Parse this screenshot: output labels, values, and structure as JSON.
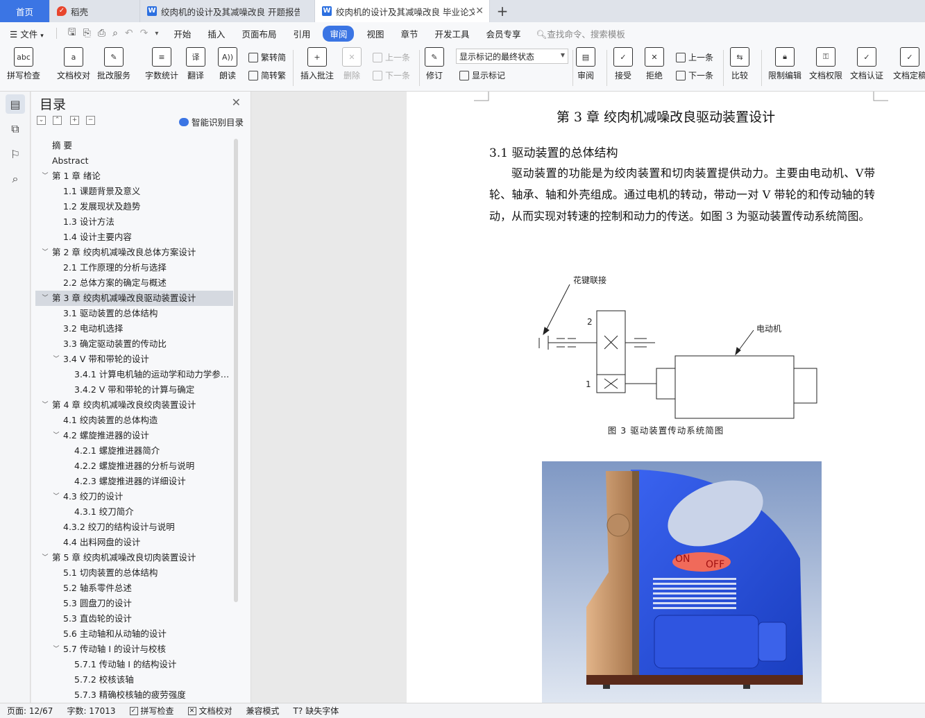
{
  "tabs": [
    {
      "label": "首页",
      "icon": "none"
    },
    {
      "label": "稻壳",
      "icon": "docer-icon"
    },
    {
      "label": "绞肉机的设计及其减噪改良 开题报告",
      "icon": "word-doc-icon"
    },
    {
      "label": "绞肉机的设计及其减噪改良 毕业论文",
      "icon": "word-doc-icon"
    }
  ],
  "menu": {
    "file": "文件",
    "items": [
      "开始",
      "插入",
      "页面布局",
      "引用",
      "审阅",
      "视图",
      "章节",
      "开发工具",
      "会员专享"
    ],
    "active": "审阅",
    "search_placeholder": "查找命令、搜索模板"
  },
  "ribbon": {
    "spellcheck": "拼写检查",
    "spellcheck_glyph": "abc",
    "doccheck": "文档校对",
    "batchservice": "批改服务",
    "wordcount": "字数统计",
    "translate": "翻译",
    "readaloud": "朗读",
    "trad": "繁转简",
    "simp": "简转繁",
    "insert_comment": "插入批注",
    "delete": "删除",
    "prev": "上一条",
    "next": "下一条",
    "revise": "修订",
    "mark_state": "显示标记的最终状态",
    "show_marks": "显示标记",
    "review": "审阅",
    "accept": "接受",
    "reject": "拒绝",
    "prev2": "上一条",
    "next2": "下一条",
    "compare": "比较",
    "restrict": "限制编辑",
    "permission": "文档权限",
    "certify": "文档认证",
    "finalize": "文档定稿"
  },
  "toc": {
    "title": "目录",
    "smart": "智能识别目录",
    "items": [
      {
        "label": "摘    要",
        "level": 1,
        "chev": ""
      },
      {
        "label": "Abstract",
        "level": 1,
        "chev": ""
      },
      {
        "label": "第 1 章  绪论",
        "level": 1,
        "chev": "v"
      },
      {
        "label": "1.1 课题背景及意义",
        "level": 2,
        "chev": ""
      },
      {
        "label": "1.2 发展现状及趋势",
        "level": 2,
        "chev": ""
      },
      {
        "label": "1.3 设计方法",
        "level": 2,
        "chev": ""
      },
      {
        "label": "1.4 设计主要内容",
        "level": 2,
        "chev": ""
      },
      {
        "label": "第 2 章  绞肉机减噪改良总体方案设计",
        "level": 1,
        "chev": "v"
      },
      {
        "label": "2.1  工作原理的分析与选择",
        "level": 2,
        "chev": ""
      },
      {
        "label": "2.2  总体方案的确定与概述",
        "level": 2,
        "chev": ""
      },
      {
        "label": "第 3 章  绞肉机减噪改良驱动装置设计",
        "level": 1,
        "chev": "v",
        "selected": true
      },
      {
        "label": "3.1 驱动装置的总体结构",
        "level": 2,
        "chev": ""
      },
      {
        "label": "3.2  电动机选择",
        "level": 2,
        "chev": ""
      },
      {
        "label": "3.3 确定驱动装置的传动比",
        "level": 2,
        "chev": ""
      },
      {
        "label": "3.4 V 带和带轮的设计",
        "level": 2,
        "chev": "v"
      },
      {
        "label": "3.4.1  计算电机轴的运动学和动力学参…",
        "level": 3,
        "chev": ""
      },
      {
        "label": "3.4.2 V 带和带轮的计算与确定",
        "level": 3,
        "chev": ""
      },
      {
        "label": "第 4 章  绞肉机减噪改良绞肉装置设计",
        "level": 1,
        "chev": "v"
      },
      {
        "label": "4.1 绞肉装置的总体构造",
        "level": 2,
        "chev": ""
      },
      {
        "label": "4.2  螺旋推进器的设计",
        "level": 2,
        "chev": "v"
      },
      {
        "label": "4.2.1 螺旋推进器简介",
        "level": 3,
        "chev": ""
      },
      {
        "label": "4.2.2 螺旋推进器的分析与说明",
        "level": 3,
        "chev": ""
      },
      {
        "label": "4.2.3 螺旋推进器的详细设计",
        "level": 3,
        "chev": ""
      },
      {
        "label": "4.3 绞刀的设计",
        "level": 2,
        "chev": "v"
      },
      {
        "label": "4.3.1 绞刀简介",
        "level": 3,
        "chev": ""
      },
      {
        "label": "4.3.2 绞刀的结构设计与说明",
        "level": 2,
        "chev": ""
      },
      {
        "label": "4.4 出料网盘的设计",
        "level": 2,
        "chev": ""
      },
      {
        "label": "第 5 章  绞肉机减噪改良切肉装置设计",
        "level": 1,
        "chev": "v"
      },
      {
        "label": "5.1 切肉装置的总体结构",
        "level": 2,
        "chev": ""
      },
      {
        "label": "5.2 轴系零件总述",
        "level": 2,
        "chev": ""
      },
      {
        "label": "5.3 圆盘刀的设计",
        "level": 2,
        "chev": ""
      },
      {
        "label": "5.3 直齿轮的设计",
        "level": 2,
        "chev": ""
      },
      {
        "label": "5.6 主动轴和从动轴的设计",
        "level": 2,
        "chev": ""
      },
      {
        "label": "5.7 传动轴 I 的设计与校核",
        "level": 2,
        "chev": "v"
      },
      {
        "label": "5.7.1 传动轴 I 的结构设计",
        "level": 3,
        "chev": ""
      },
      {
        "label": "5.7.2 校核该轴",
        "level": 3,
        "chev": ""
      },
      {
        "label": "5.7.3  精确校核轴的疲劳强度",
        "level": 3,
        "chev": ""
      }
    ]
  },
  "document": {
    "chapter_title": "第 3 章  绞肉机减噪改良驱动装置设计",
    "section_title": "3.1 驱动装置的总体结构",
    "paragraph": "驱动装置的功能是为绞肉装置和切肉装置提供动力。主要由电动机、V带轮、轴承、轴和外壳组成。通过电机的转动，带动一对 V 带轮的和传动轴的转动，从而实现对转速的控制和动力的传送。如图 3 为驱动装置传动系统简图。",
    "figure": {
      "label_spline": "花键联接",
      "label_motor": "电动机",
      "label_2": "2",
      "label_1": "1",
      "caption": "图 3  驱动装置传动系统简图"
    },
    "render": {
      "on": "ON",
      "off": "OFF",
      "body_color": "#2a4fd8",
      "wood_color": "#c9956a"
    }
  },
  "status": {
    "page": "页面: 12/67",
    "words": "字数: 17013",
    "spell": "拼写检查",
    "proof": "文档校对",
    "compat": "兼容模式",
    "missing_font": "缺失字体"
  }
}
